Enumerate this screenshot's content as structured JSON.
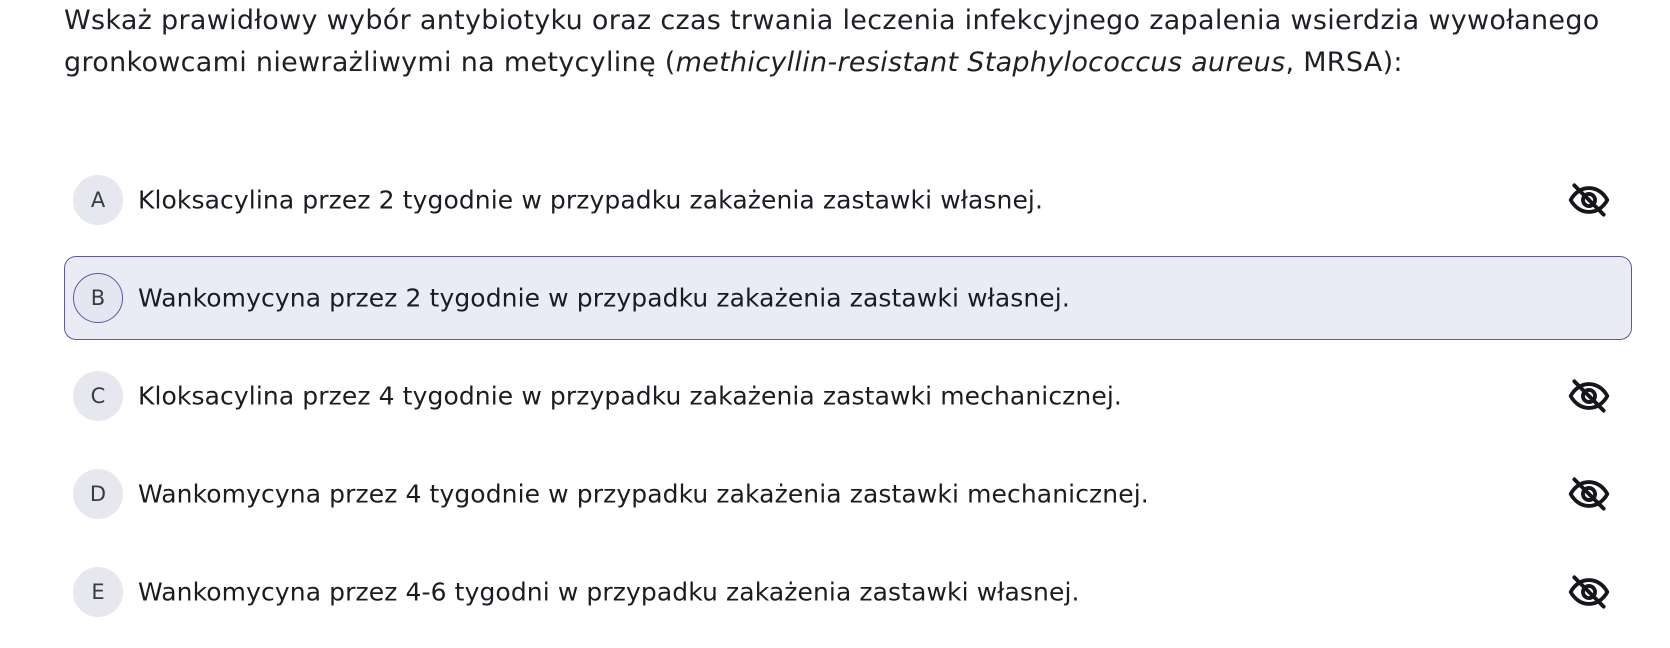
{
  "question": {
    "text_before": "Wskaż prawidłowy wybór antybiotyku oraz czas trwania leczenia infekcyjnego zapalenia wsierdzia wywołanego gronkowcami niewrażliwymi na metycylinę (",
    "latin_term": "methicyllin-resistant Staphylococcus aureus",
    "text_after": ", MRSA):"
  },
  "options": [
    {
      "letter": "A",
      "text": "Kloksacylina przez 2 tygodnie w przypadku zakażenia zastawki własnej.",
      "selected": false,
      "icon": "eye-off-icon"
    },
    {
      "letter": "B",
      "text": "Wankomycyna przez 2 tygodnie w przypadku zakażenia zastawki własnej.",
      "selected": true,
      "icon": null
    },
    {
      "letter": "C",
      "text": "Kloksacylina przez 4 tygodnie w przypadku zakażenia zastawki mechanicznej.",
      "selected": false,
      "icon": "eye-off-icon"
    },
    {
      "letter": "D",
      "text": "Wankomycyna przez 4 tygodnie w przypadku zakażenia zastawki mechanicznej.",
      "selected": false,
      "icon": "eye-off-icon"
    },
    {
      "letter": "E",
      "text": "Wankomycyna przez 4-6 tygodni w przypadku zakażenia zastawki własnej.",
      "selected": false,
      "icon": "eye-off-icon"
    }
  ],
  "colors": {
    "selected_bg": "#ebebf6",
    "selected_border": "#5a5a9c",
    "letter_bg": "#e6e7ef",
    "text": "#1b1b22"
  }
}
